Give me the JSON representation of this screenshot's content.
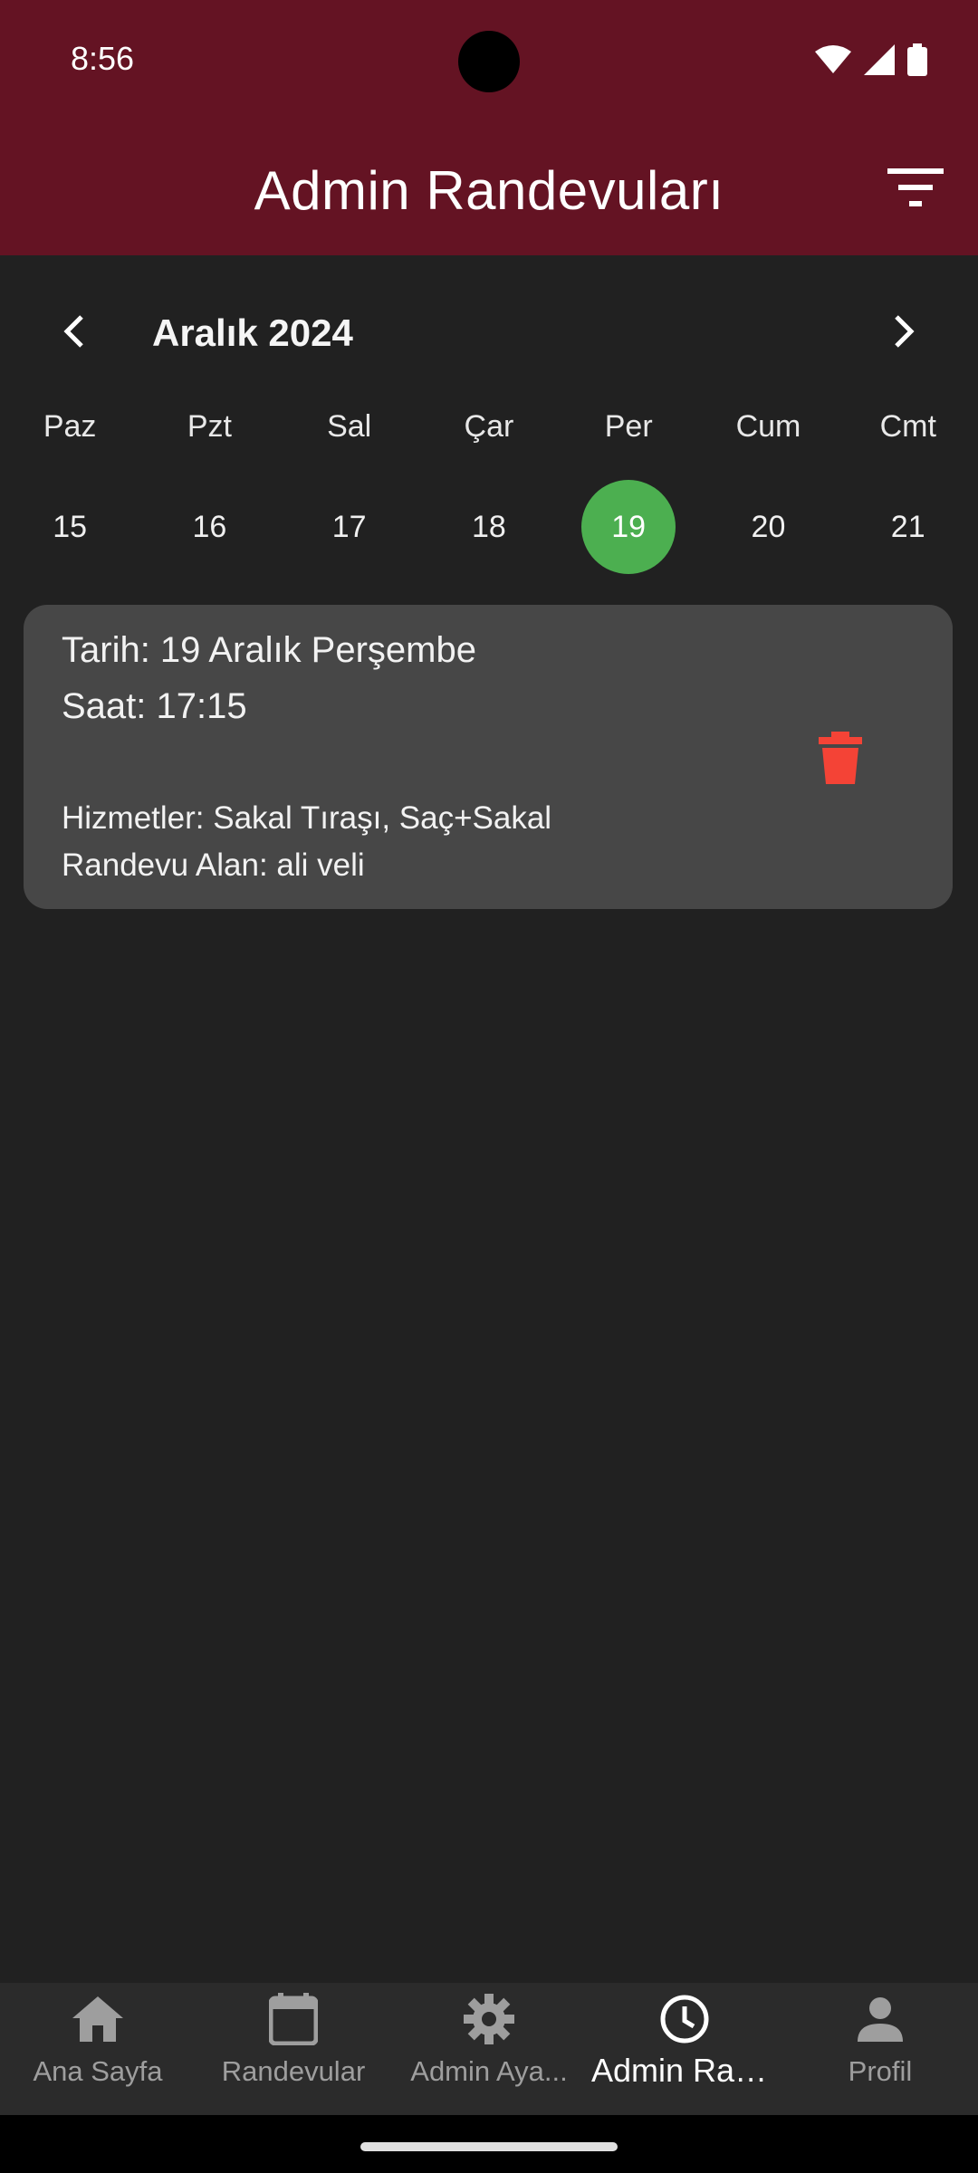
{
  "status_bar": {
    "time": "8:56"
  },
  "app_bar": {
    "title": "Admin Randevuları",
    "filter_icon": "filter-icon"
  },
  "calendar": {
    "month_label": "Aralık 2024",
    "days": [
      {
        "name": "Paz",
        "num": "15"
      },
      {
        "name": "Pzt",
        "num": "16"
      },
      {
        "name": "Sal",
        "num": "17"
      },
      {
        "name": "Çar",
        "num": "18"
      },
      {
        "name": "Per",
        "num": "19"
      },
      {
        "name": "Cum",
        "num": "20"
      },
      {
        "name": "Cmt",
        "num": "21"
      }
    ],
    "selected_day": "19",
    "selected_color": "#4caf50"
  },
  "appointment": {
    "date": "Tarih: 19 Aralık Perşembe",
    "time": "Saat: 17:15",
    "services": "Hizmetler: Sakal Tıraşı, Saç+Sakal",
    "customer": "Randevu Alan: ali veli",
    "delete_color": "#f44336"
  },
  "bottom_nav": {
    "items": [
      {
        "label": "Ana Sayfa",
        "icon": "home-icon"
      },
      {
        "label": "Randevular",
        "icon": "calendar-icon"
      },
      {
        "label": "Admin Aya...",
        "icon": "gear-icon"
      },
      {
        "label": "Admin Ran...",
        "icon": "clock-icon",
        "active": true
      },
      {
        "label": "Profil",
        "icon": "person-icon"
      }
    ]
  },
  "colors": {
    "app_bar": "#641323",
    "background": "#212121",
    "card": "#474747"
  }
}
